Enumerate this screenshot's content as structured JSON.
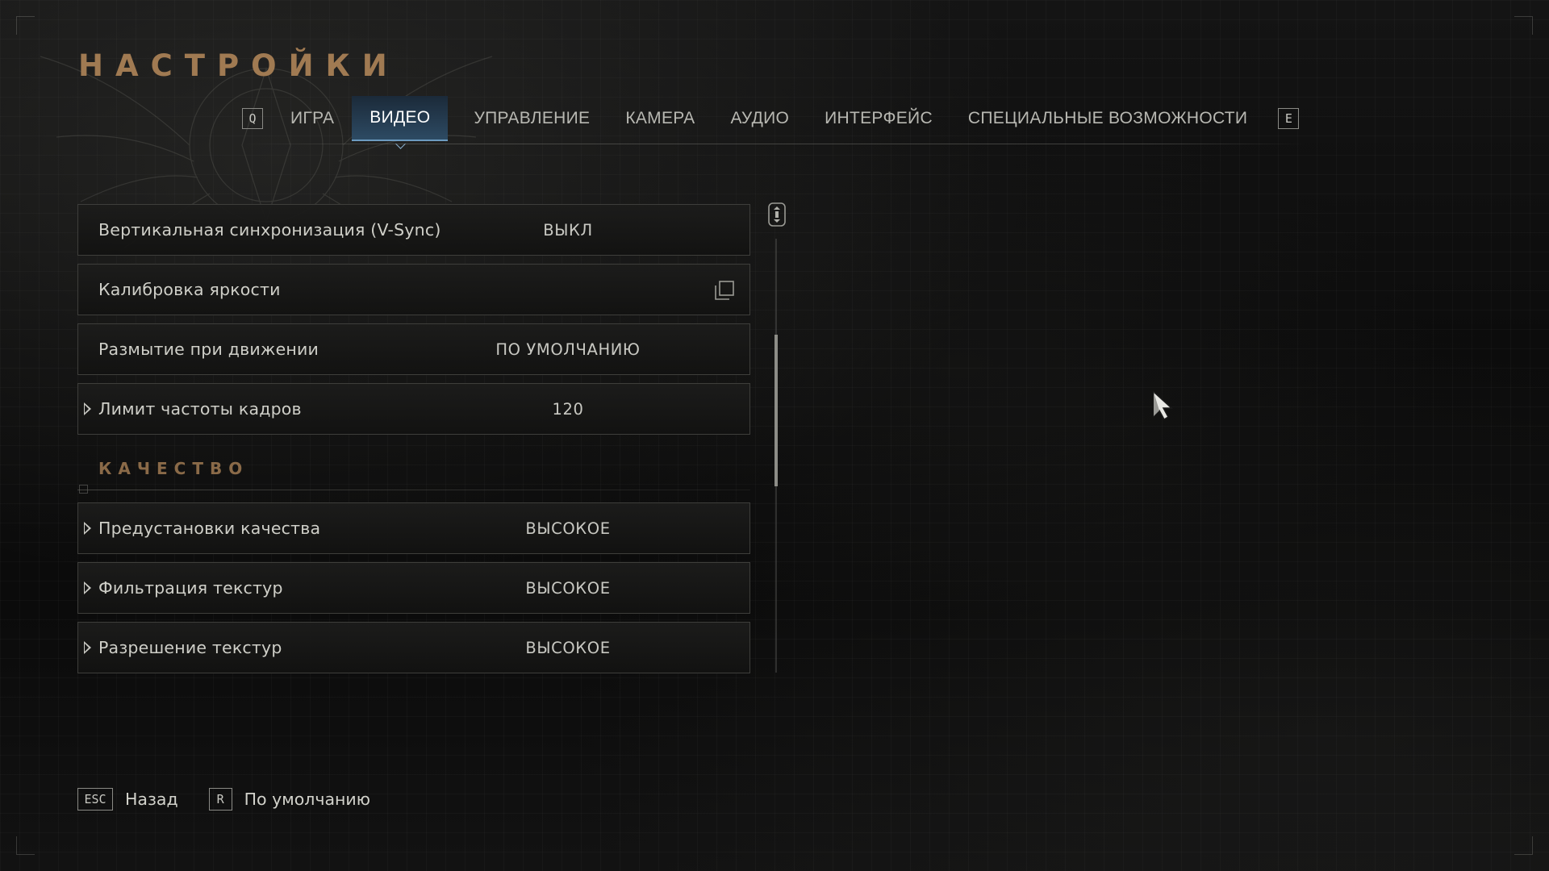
{
  "header": {
    "title": "НАСТРОЙКИ"
  },
  "tabs": {
    "prev_key": "Q",
    "next_key": "E",
    "items": [
      {
        "label": "ИГРА",
        "active": false
      },
      {
        "label": "ВИДЕО",
        "active": true
      },
      {
        "label": "УПРАВЛЕНИЕ",
        "active": false
      },
      {
        "label": "КАМЕРА",
        "active": false
      },
      {
        "label": "АУДИО",
        "active": false
      },
      {
        "label": "ИНТЕРФЕЙС",
        "active": false
      },
      {
        "label": "СПЕЦИАЛЬНЫЕ ВОЗМОЖНОСТИ",
        "active": false
      }
    ]
  },
  "settings": {
    "vsync": {
      "label": "Вертикальная синхронизация (V-Sync)",
      "value": "ВЫКЛ"
    },
    "brightness": {
      "label": "Калибровка яркости",
      "icon": "open-window-icon"
    },
    "motion_blur": {
      "label": "Размытие при движении",
      "value": "ПО УМОЛЧАНИЮ"
    },
    "frame_limit": {
      "label": "Лимит частоты кадров",
      "value": "120"
    },
    "quality_section": {
      "title": "КАЧЕСТВО"
    },
    "quality_preset": {
      "label": "Предустановки качества",
      "value": "ВЫСОКОЕ"
    },
    "texture_filtering": {
      "label": "Фильтрация текстур",
      "value": "ВЫСОКОЕ"
    },
    "texture_resolution": {
      "label": "Разрешение текстур",
      "value": "ВЫСОКОЕ"
    }
  },
  "scrollbar": {
    "position_fraction": 0.34
  },
  "footer": {
    "back": {
      "key": "ESC",
      "label": "Назад"
    },
    "defaults": {
      "key": "R",
      "label": "По умолчанию"
    }
  },
  "colors": {
    "title": "#a07a52",
    "section": "#8a6a48",
    "active_tab": "#2d4a63",
    "text": "#cfcfc8"
  }
}
